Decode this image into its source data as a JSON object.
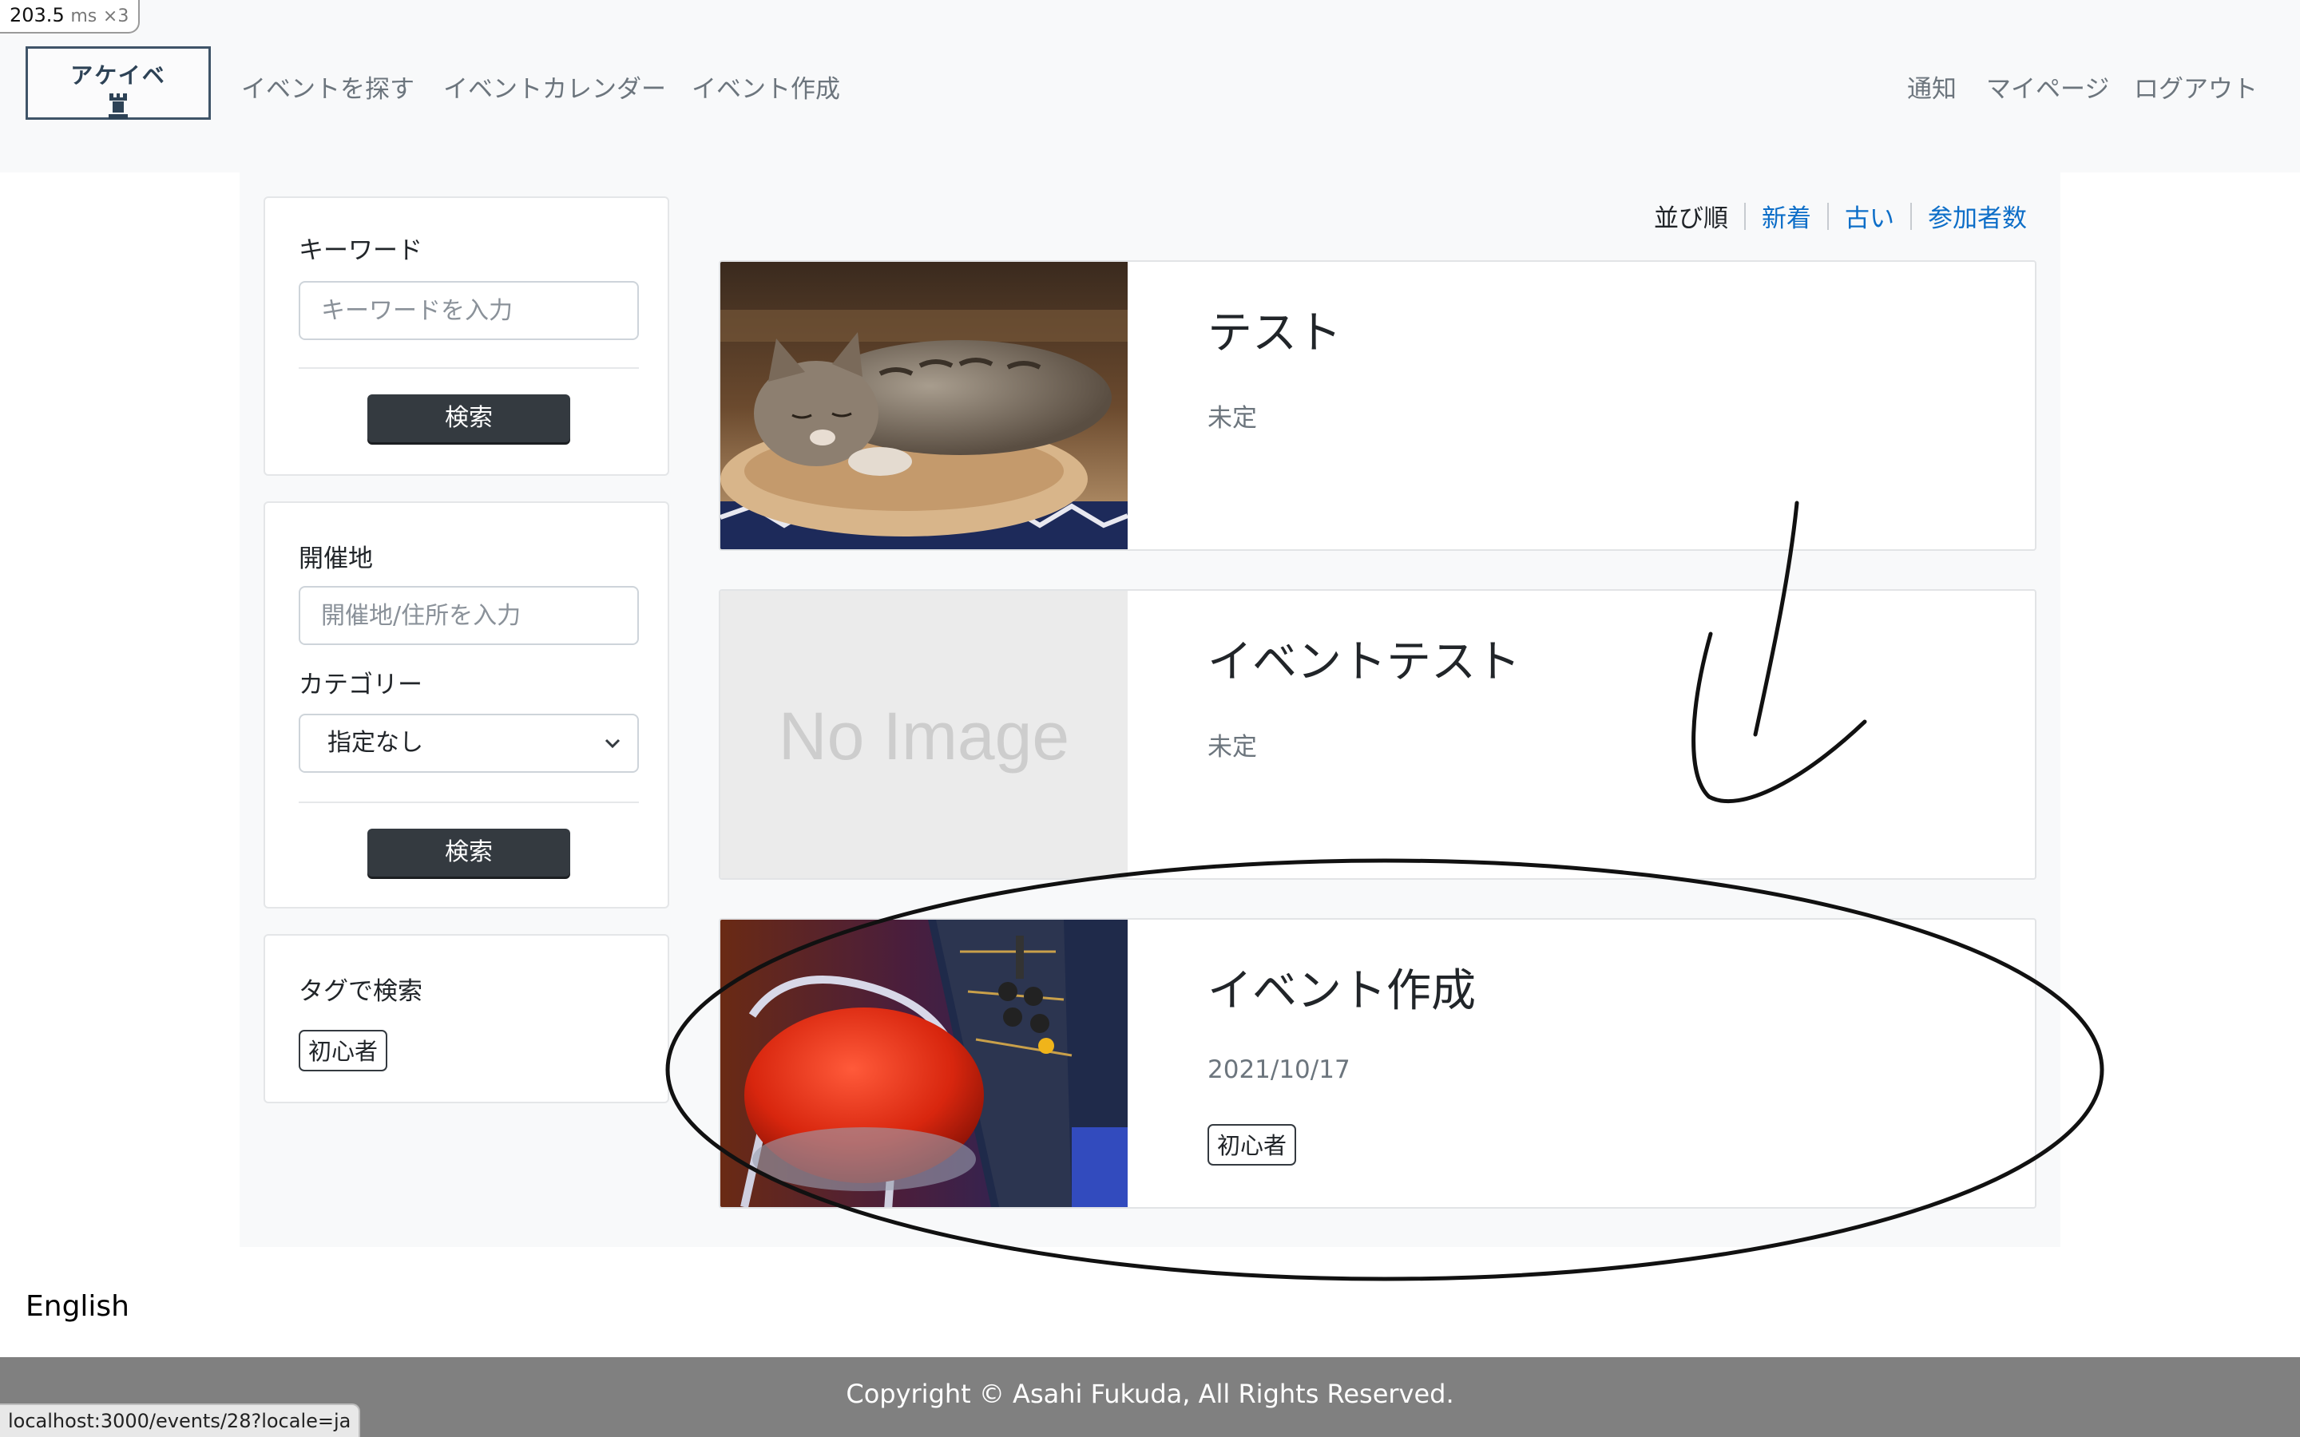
{
  "perf": {
    "value": "203.5",
    "unit": "ms",
    "multiplier": "×3"
  },
  "header": {
    "logo_text": "アケイベ",
    "nav_left": [
      "イベントを探す",
      "イベントカレンダー",
      "イベント作成"
    ],
    "nav_right": [
      "通知",
      "マイページ",
      "ログアウト"
    ]
  },
  "sidebar": {
    "keyword": {
      "label": "キーワード",
      "placeholder": "キーワードを入力",
      "button": "検索"
    },
    "location": {
      "label": "開催地",
      "placeholder": "開催地/住所を入力",
      "category_label": "カテゴリー",
      "category_selected": "指定なし",
      "button": "検索"
    },
    "tags": {
      "label": "タグで検索",
      "items": [
        "初心者"
      ]
    }
  },
  "sort": {
    "label": "並び順",
    "options": [
      "新着",
      "古い",
      "参加者数"
    ]
  },
  "events": [
    {
      "title": "テスト",
      "date": "未定",
      "image": "cat-photo",
      "tags": []
    },
    {
      "title": "イベントテスト",
      "date": "未定",
      "image": "no-image",
      "image_text": "No Image",
      "tags": []
    },
    {
      "title": "イベント作成",
      "date": "2021/10/17",
      "image": "arcade-photo",
      "tags": [
        "初心者"
      ]
    }
  ],
  "language_link": "English",
  "footer": {
    "copyright": "Copyright © Asahi Fukuda, All Rights Reserved."
  },
  "status_bar": {
    "url": "localhost:3000/events/28?locale=ja"
  },
  "colors": {
    "link": "#0d6ec8",
    "button": "#343a40",
    "footer": "#808080",
    "navbar": "#f8f9fa"
  }
}
